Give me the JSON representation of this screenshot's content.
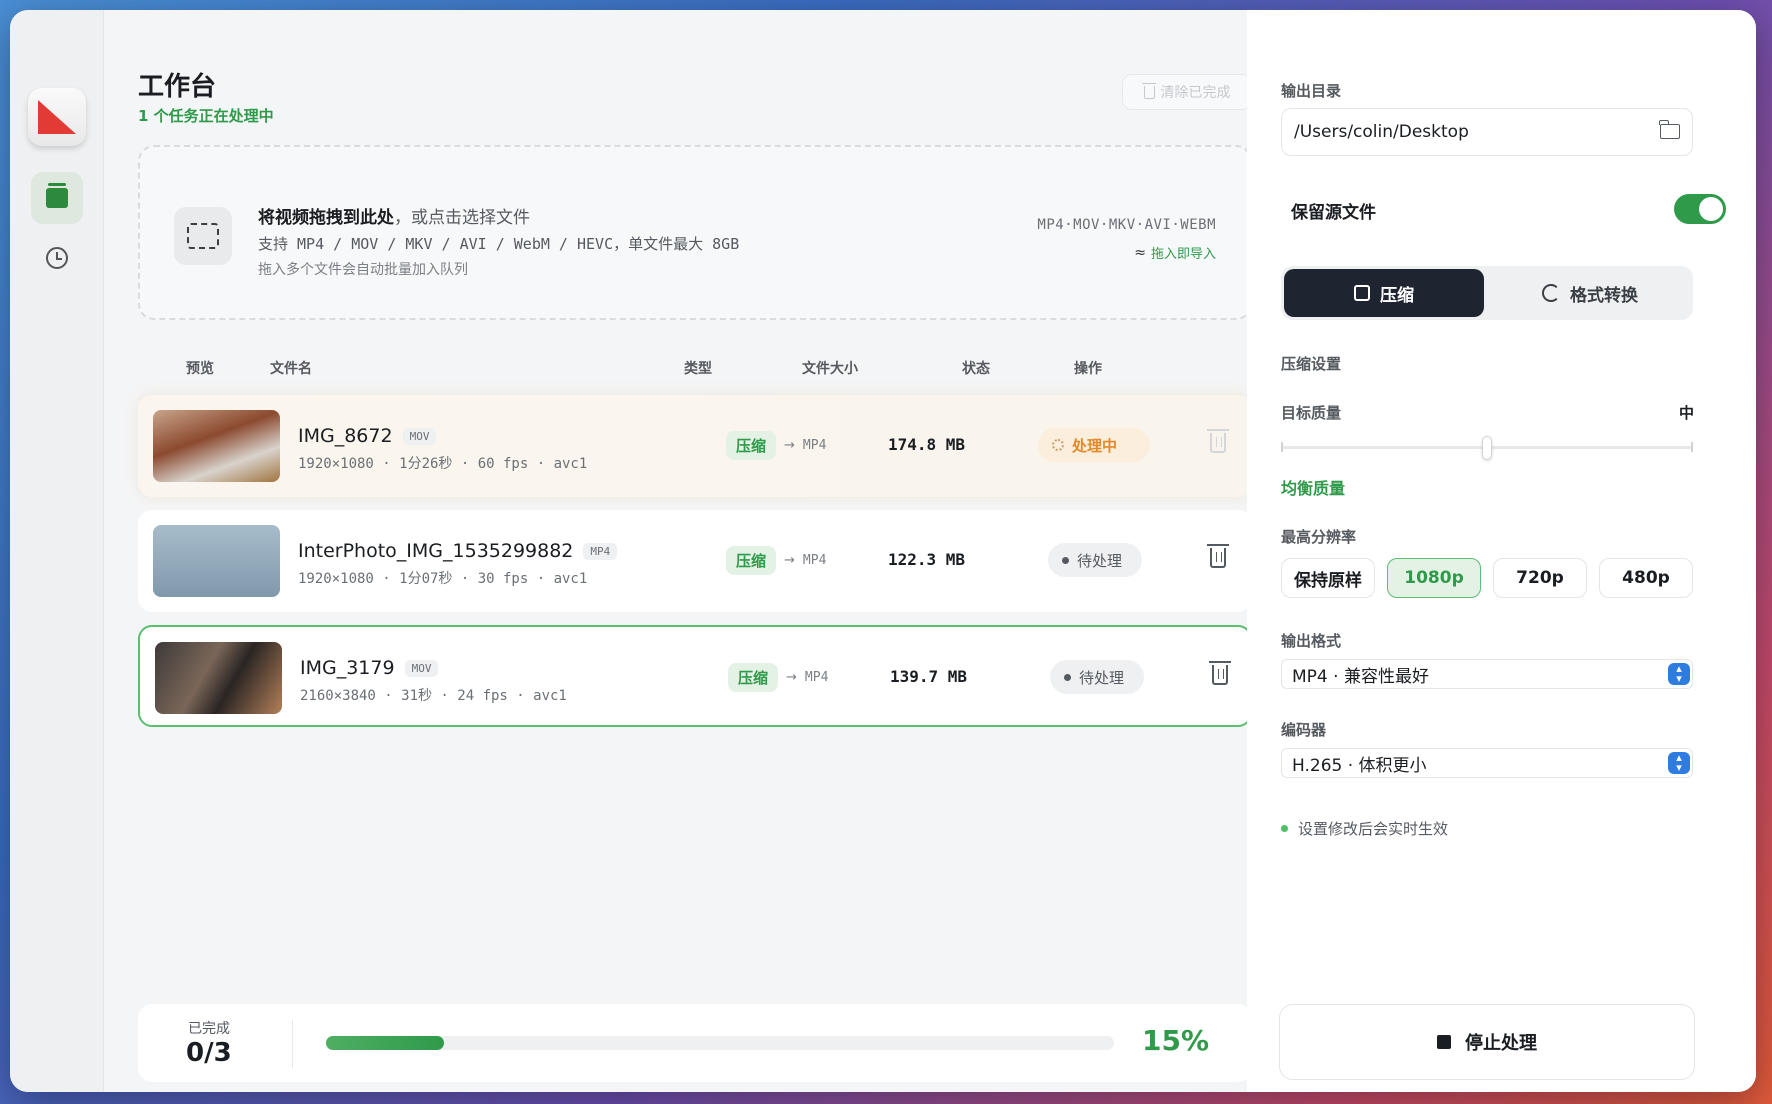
{
  "main": {
    "title": "工作台",
    "subtitle": "1 个任务正在处理中",
    "clear_label": "清除已完成"
  },
  "dropzone": {
    "line1_bold": "将视频拖拽到此处",
    "line1_rest": "，或点击选择文件",
    "line2": "支持 MP4 / MOV / MKV / AVI / WebM / HEVC，单文件最大 8GB",
    "line3": "拖入多个文件会自动批量加入队列",
    "formats": "MP4·MOV·MKV·AVI·WEBM",
    "hint": "拖入即导入"
  },
  "columns": {
    "preview": "预览",
    "filename": "文件名",
    "type": "类型",
    "size": "文件大小",
    "status": "状态",
    "action": "操作"
  },
  "rows": [
    {
      "name": "IMG_8672",
      "tag": "MOV",
      "meta": "1920×1080 · 1分26秒 · 60 fps · avc1",
      "type": "压缩",
      "target": "MP4",
      "size": "174.8 MB",
      "status": "处理中"
    },
    {
      "name": "InterPhoto_IMG_1535299882",
      "tag": "MP4",
      "meta": "1920×1080 · 1分07秒 · 30 fps · avc1",
      "type": "压缩",
      "target": "MP4",
      "size": "122.3 MB",
      "status": "待处理"
    },
    {
      "name": "IMG_3179",
      "tag": "MOV",
      "meta": "2160×3840 · 31秒 · 24 fps · avc1",
      "type": "压缩",
      "target": "MP4",
      "size": "139.7 MB",
      "status": "待处理"
    }
  ],
  "progress": {
    "done_label": "已完成",
    "done_value": "0/3",
    "percent_text": "15%",
    "fraction": 0.15
  },
  "panel": {
    "output_dir_label": "输出目录",
    "output_dir": "/Users/colin/Desktop",
    "keep_source_label": "保留源文件",
    "keep_source": true,
    "mode_compress": "压缩",
    "mode_convert": "格式转换",
    "compress_settings": "压缩设置",
    "quality_label": "目标质量",
    "quality_value": "中",
    "quality_level": 0.5,
    "quality_desc": "均衡质量",
    "max_res_label": "最高分辨率",
    "resolutions": [
      "保持原样",
      "1080p",
      "720p",
      "480p"
    ],
    "selected_resolution": "1080p",
    "output_format_label": "输出格式",
    "output_format": "MP4 · 兼容性最好",
    "encoder_label": "编码器",
    "encoder": "H.265 · 体积更小",
    "note": "设置修改后会实时生效",
    "stop_label": "停止处理"
  },
  "colors": {
    "accent_green": "#2f9a4a",
    "processing_orange": "#e08a2a",
    "dark_button": "#1e2530"
  }
}
